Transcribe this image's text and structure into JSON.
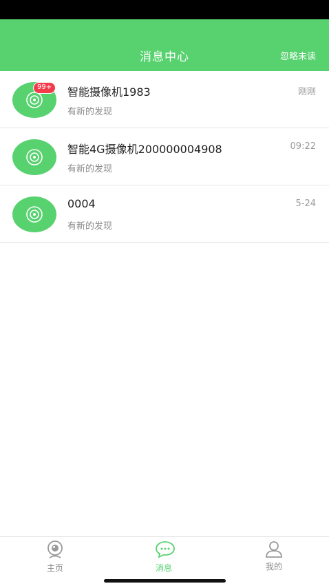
{
  "header": {
    "title": "消息中心",
    "action_label": "忽略未读"
  },
  "messages": [
    {
      "title": "智能摄像机1983",
      "subtitle": "有新的发现",
      "time": "刚刚",
      "badge": "99+",
      "icon": "camera-icon"
    },
    {
      "title": "智能4G摄像机200000004908",
      "subtitle": "有新的发现",
      "time": "09:22",
      "icon": "camera-icon"
    },
    {
      "title": "0004",
      "subtitle": "有新的发现",
      "time": "5-24",
      "icon": "camera-icon"
    }
  ],
  "tabbar": {
    "tabs": [
      {
        "label": "主页",
        "icon": "webcam-icon"
      },
      {
        "label": "消息",
        "icon": "chat-icon",
        "active": true
      },
      {
        "label": "我的",
        "icon": "user-icon"
      }
    ]
  },
  "colors": {
    "accent": "#57d26f",
    "badge": "#f23b4b"
  }
}
